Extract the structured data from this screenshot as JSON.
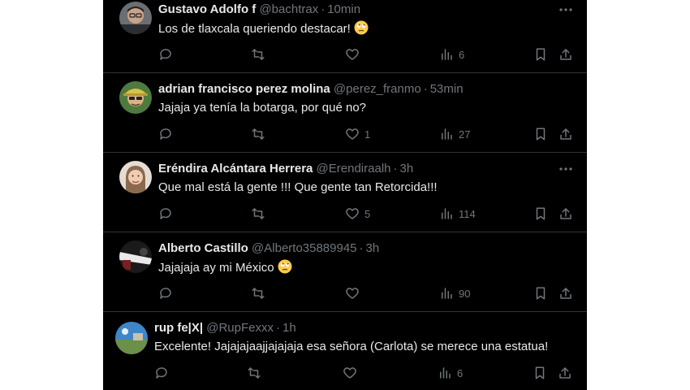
{
  "tweets": [
    {
      "name": "Gustavo Adolfo f",
      "handle": "@bachtrax",
      "time": "10min",
      "text": "Los de tlaxcala queriendo destacar!",
      "emoji": "face-with-rolling-eyes",
      "replies": "",
      "retweets": "",
      "likes": "",
      "views": "6"
    },
    {
      "name": "adrian francisco perez molina",
      "handle": "@perez_franmo",
      "time": "53min",
      "text": "Jajaja ya tenía la botarga, por qué no?",
      "emoji": "",
      "replies": "",
      "retweets": "",
      "likes": "1",
      "views": "27"
    },
    {
      "name": "Eréndira Alcántara Herrera",
      "handle": "@Erendiraalh",
      "time": "3h",
      "text": "Que mal está la gente !!! Que gente tan Retorcida!!!",
      "emoji": "",
      "replies": "",
      "retweets": "",
      "likes": "5",
      "views": "114"
    },
    {
      "name": "Alberto Castillo",
      "handle": "@Alberto35889945",
      "time": "3h",
      "text": "Jajajaja ay mi México",
      "emoji": "face-with-rolling-eyes",
      "replies": "",
      "retweets": "",
      "likes": "",
      "views": "90"
    },
    {
      "name": "rup fe|X|",
      "handle": "@RupFexxx",
      "time": "1h",
      "text": "Excelente! Jajajajaajjajajaja esa señora (Carlota) se merece una estatua!",
      "emoji": "",
      "replies": "",
      "retweets": "",
      "likes": "",
      "views": "6"
    }
  ],
  "separator": "·",
  "icons": {
    "reply": "reply-icon",
    "retweet": "retweet-icon",
    "like": "like-icon",
    "views": "views-icon",
    "bookmark": "bookmark-icon",
    "share": "share-icon",
    "more": "more-icon"
  },
  "colors": {
    "background": "#000000",
    "text": "#e7e9ea",
    "muted": "#71767b",
    "divider": "#2f3336"
  }
}
